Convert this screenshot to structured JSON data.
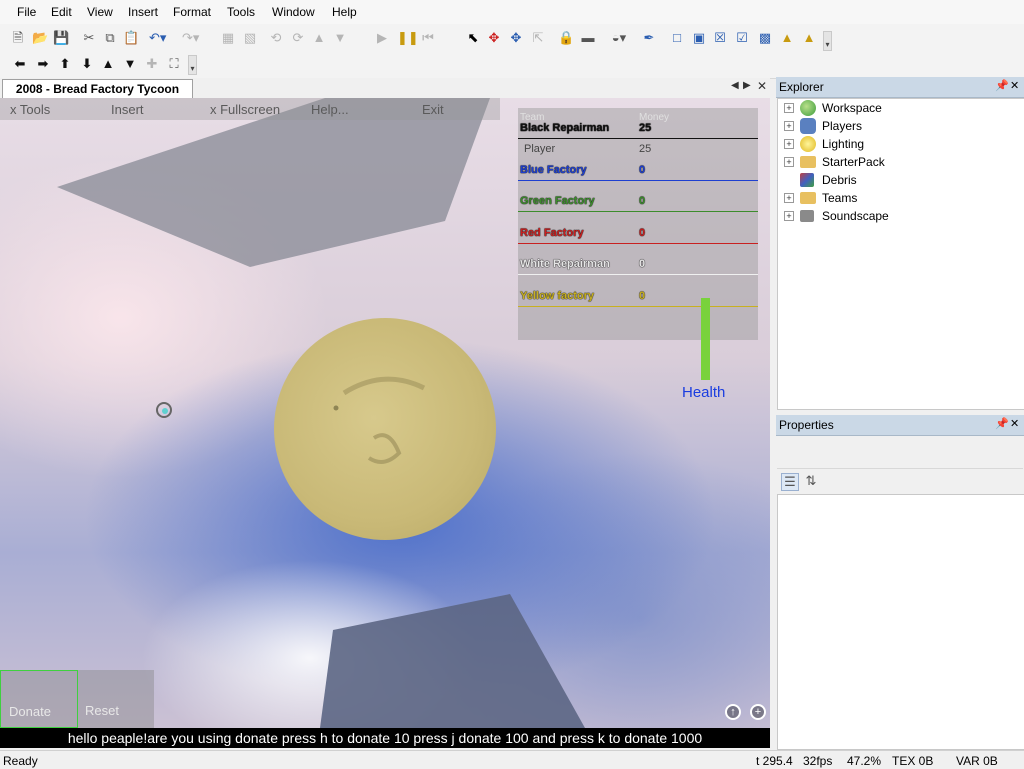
{
  "menu": {
    "items": [
      "File",
      "Edit",
      "View",
      "Insert",
      "Format",
      "Tools",
      "Window",
      "Help"
    ]
  },
  "toolbar1": {
    "icons": [
      "new-icon",
      "open-icon",
      "save-icon",
      "cut-icon",
      "copy-icon",
      "paste-icon",
      "undo-icon",
      "redo-icon",
      "group-icon",
      "ungroup-icon",
      "rotate-left-icon",
      "rotate-right-icon",
      "move-up-icon",
      "move-down-icon",
      "play-icon",
      "pause-icon",
      "reset-icon",
      "select-icon",
      "move-icon",
      "scale-icon",
      "resize-icon",
      "lock-icon",
      "anchor-icon",
      "paint-icon",
      "dropper-icon",
      "surface-smooth-icon",
      "surface-glue-icon",
      "surface-weld-icon",
      "surface-studs-icon",
      "surface-inlet-icon",
      "surface-hinge-icon",
      "surface-motor-icon"
    ]
  },
  "toolbar2": {
    "icons": [
      "pan-left-icon",
      "pan-right-icon",
      "tilt-up-icon",
      "tilt-down-icon",
      "zoom-in-icon",
      "zoom-out-icon",
      "zoom-extents-icon",
      "fullscreen-icon"
    ]
  },
  "document": {
    "tab_title": "2008 - Bread Factory Tycoon"
  },
  "game": {
    "topbar": {
      "tools": "x Tools",
      "insert": "Insert",
      "fullscreen": "x Fullscreen",
      "help": "Help...",
      "exit": "Exit"
    },
    "leaderboard": {
      "col_team": "Team",
      "col_money": "Money",
      "rows": [
        {
          "name": "Black Repairman",
          "money": "25",
          "color": "#111111"
        },
        {
          "name": "Player",
          "money": "25",
          "color": "#444444"
        },
        {
          "name": "Blue Factory",
          "money": "0",
          "color": "#1e3fd0"
        },
        {
          "name": "Green Factory",
          "money": "0",
          "color": "#3c8c2c"
        },
        {
          "name": "Red Factory",
          "money": "0",
          "color": "#c82020"
        },
        {
          "name": "White Repairman",
          "money": "0",
          "color": "#e6e6e6"
        },
        {
          "name": "Yellow factory",
          "money": "0",
          "color": "#c8b020"
        }
      ]
    },
    "health": {
      "label": "Health",
      "level": 1.0
    },
    "buttons": {
      "donate": "Donate",
      "reset": "Reset"
    },
    "message": "hello peaple!are you using donate press h to donate 10 press j donate 100 and press k to donate 1000"
  },
  "explorer": {
    "title": "Explorer",
    "items": [
      {
        "label": "Workspace",
        "icon": "workspace-globe-icon",
        "expandable": true
      },
      {
        "label": "Players",
        "icon": "players-icon",
        "expandable": true
      },
      {
        "label": "Lighting",
        "icon": "lightbulb-icon",
        "expandable": true
      },
      {
        "label": "StarterPack",
        "icon": "folder-icon",
        "expandable": true
      },
      {
        "label": "Debris",
        "icon": "debris-icon",
        "expandable": false
      },
      {
        "label": "Teams",
        "icon": "folder-icon",
        "expandable": true
      },
      {
        "label": "Soundscape",
        "icon": "speaker-icon",
        "expandable": true
      }
    ]
  },
  "properties": {
    "title": "Properties"
  },
  "status": {
    "left": "Ready",
    "time": "t 295.4",
    "fps": "32fps",
    "percent": "47.2%",
    "tex": "TEX 0B",
    "var": "VAR 0B"
  }
}
